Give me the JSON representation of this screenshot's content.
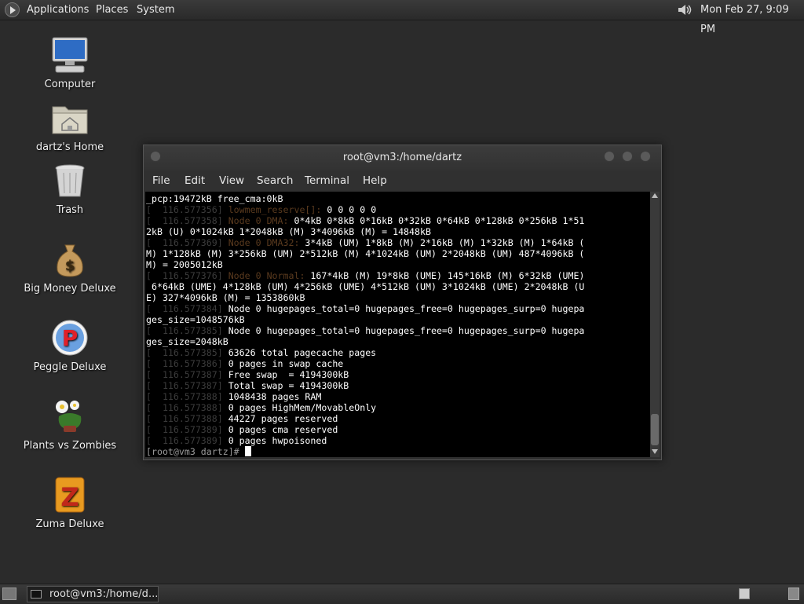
{
  "top_panel": {
    "menus": [
      "Applications",
      "Places",
      "System"
    ],
    "volume_icon": "speaker-icon",
    "clock": "Mon Feb 27,  9:09 PM"
  },
  "desktop_icons": [
    {
      "label": "Computer",
      "icon": "computer-icon"
    },
    {
      "label": "dartz's Home",
      "icon": "home-folder-icon"
    },
    {
      "label": "Trash",
      "icon": "trash-icon"
    },
    {
      "label": "Big Money Deluxe",
      "icon": "money-bag-icon"
    },
    {
      "label": "Peggle Deluxe",
      "icon": "peggle-icon"
    },
    {
      "label": "Plants vs Zombies",
      "icon": "plants-icon"
    },
    {
      "label": "Zuma Deluxe",
      "icon": "zuma-icon"
    }
  ],
  "terminal": {
    "title": "root@vm3:/home/dartz",
    "menus": [
      "File",
      "Edit",
      "View",
      "Search",
      "Terminal",
      "Help"
    ],
    "lines": [
      {
        "ts": "",
        "lvl": "",
        "text": "_pcp:19472kB free_cma:0kB"
      },
      {
        "ts": "[  116.577356] ",
        "lvl": "lowmem_reserve[]:",
        "text": " 0 0 0 0 0"
      },
      {
        "ts": "[  116.577358] ",
        "lvl": "Node 0 DMA:",
        "text": " 0*4kB 0*8kB 0*16kB 0*32kB 0*64kB 0*128kB 0*256kB 1*51"
      },
      {
        "ts": "",
        "lvl": "",
        "text": "2kB (U) 0*1024kB 1*2048kB (M) 3*4096kB (M) = 14848kB"
      },
      {
        "ts": "[  116.577369] ",
        "lvl": "Node 0 DMA32:",
        "text": " 3*4kB (UM) 1*8kB (M) 2*16kB (M) 1*32kB (M) 1*64kB ("
      },
      {
        "ts": "",
        "lvl": "",
        "text": "M) 1*128kB (M) 3*256kB (UM) 2*512kB (M) 4*1024kB (UM) 2*2048kB (UM) 487*4096kB ("
      },
      {
        "ts": "",
        "lvl": "",
        "text": "M) = 2005012kB"
      },
      {
        "ts": "[  116.577376] ",
        "lvl": "Node 0 Normal:",
        "text": " 167*4kB (M) 19*8kB (UME) 145*16kB (M) 6*32kB (UME)"
      },
      {
        "ts": "",
        "lvl": "",
        "text": " 6*64kB (UME) 4*128kB (UM) 4*256kB (UME) 4*512kB (UM) 3*1024kB (UME) 2*2048kB (U"
      },
      {
        "ts": "",
        "lvl": "",
        "text": "E) 327*4096kB (M) = 1353860kB"
      },
      {
        "ts": "[  116.577384] ",
        "lvl": "",
        "text": "Node 0 hugepages_total=0 hugepages_free=0 hugepages_surp=0 hugepa"
      },
      {
        "ts": "",
        "lvl": "",
        "text": "ges_size=1048576kB"
      },
      {
        "ts": "[  116.577385] ",
        "lvl": "",
        "text": "Node 0 hugepages_total=0 hugepages_free=0 hugepages_surp=0 hugepa"
      },
      {
        "ts": "",
        "lvl": "",
        "text": "ges_size=2048kB"
      },
      {
        "ts": "[  116.577385] ",
        "lvl": "",
        "text": "63626 total pagecache pages"
      },
      {
        "ts": "[  116.577386] ",
        "lvl": "",
        "text": "0 pages in swap cache"
      },
      {
        "ts": "[  116.577387] ",
        "lvl": "",
        "text": "Free swap  = 4194300kB"
      },
      {
        "ts": "[  116.577387] ",
        "lvl": "",
        "text": "Total swap = 4194300kB"
      },
      {
        "ts": "[  116.577388] ",
        "lvl": "",
        "text": "1048438 pages RAM"
      },
      {
        "ts": "[  116.577388] ",
        "lvl": "",
        "text": "0 pages HighMem/MovableOnly"
      },
      {
        "ts": "[  116.577388] ",
        "lvl": "",
        "text": "44227 pages reserved"
      },
      {
        "ts": "[  116.577389] ",
        "lvl": "",
        "text": "0 pages cma reserved"
      },
      {
        "ts": "[  116.577389] ",
        "lvl": "",
        "text": "0 pages hwpoisoned"
      }
    ],
    "prompt": "[root@vm3 dartz]# "
  },
  "bottom_panel": {
    "task_label": "root@vm3:/home/d..."
  },
  "colors": {
    "desktop_bg": "#2b2b2b",
    "terminal_bg": "#000000",
    "terminal_fg": "#ffffff"
  }
}
